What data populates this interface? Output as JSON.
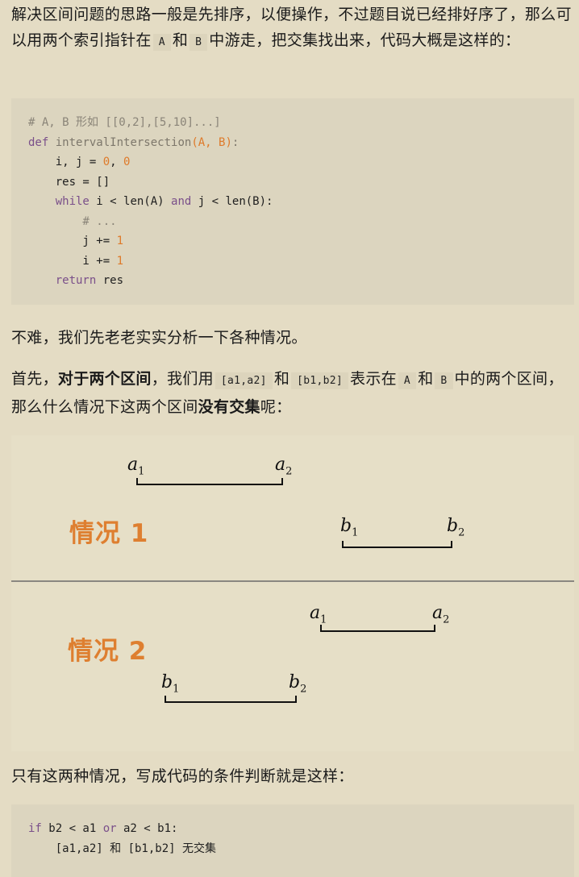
{
  "intro": {
    "text1": "解决区间问题的思路一般是先排序，以便操作，不过题目说已经排好序了，那么可以用两个索引指针在",
    "code_a": "A",
    "and1": "和",
    "code_b": "B",
    "text2": "中游走，把交集找出来，代码大概是这样的："
  },
  "code1": {
    "lines": [
      [
        {
          "t": "# A, B 形如 [[0,2],[5,10]...]",
          "c": "cm"
        }
      ],
      [
        {
          "t": "def",
          "c": "kw"
        },
        {
          "t": " intervalIntersection",
          "c": "fn"
        },
        {
          "t": "(A, B)",
          "c": "num"
        },
        {
          "t": ":",
          "c": "fn"
        }
      ],
      [
        {
          "t": "    i, j = ",
          "c": ""
        },
        {
          "t": "0",
          "c": "num"
        },
        {
          "t": ", ",
          "c": ""
        },
        {
          "t": "0",
          "c": "num"
        }
      ],
      [
        {
          "t": "    res = []",
          "c": ""
        }
      ],
      [
        {
          "t": "    ",
          "c": ""
        },
        {
          "t": "while",
          "c": "kw"
        },
        {
          "t": " i < len(A) ",
          "c": ""
        },
        {
          "t": "and",
          "c": "kw"
        },
        {
          "t": " j < len(B):",
          "c": ""
        }
      ],
      [
        {
          "t": "        # ...",
          "c": "cm"
        }
      ],
      [
        {
          "t": "        j += ",
          "c": ""
        },
        {
          "t": "1",
          "c": "num"
        }
      ],
      [
        {
          "t": "        i += ",
          "c": ""
        },
        {
          "t": "1",
          "c": "num"
        }
      ],
      [
        {
          "t": "    ",
          "c": ""
        },
        {
          "t": "return",
          "c": "kw"
        },
        {
          "t": " res",
          "c": ""
        }
      ]
    ]
  },
  "para2": "不难，我们先老老实实分析一下各种情况。",
  "para3": {
    "t1": "首先，",
    "b1": "对于两个区间",
    "t2": "，我们用",
    "c1": "[a1,a2]",
    "t3": "和",
    "c2": "[b1,b2]",
    "t4": "表示在",
    "c3": "A",
    "t5": "和",
    "c4": "B",
    "t6": "中的两个区间，那么什么情况下这两个区间",
    "b2": "没有交集",
    "t7": "呢："
  },
  "illustration": {
    "case1": "情况 1",
    "case2": "情况 2",
    "a1": "a",
    "a2": "a",
    "b1": "b",
    "b2": "b",
    "s1": "1",
    "s2": "2"
  },
  "para4": "只有这两种情况，写成代码的条件判断就是这样：",
  "code2": {
    "lines": [
      [
        {
          "t": "if",
          "c": "kw"
        },
        {
          "t": " b2 < a1 ",
          "c": ""
        },
        {
          "t": "or",
          "c": "kw"
        },
        {
          "t": " a2 < b1:",
          "c": ""
        }
      ],
      [
        {
          "t": "    [a1,a2] 和 [b1,b2] 无交集",
          "c": ""
        }
      ]
    ]
  }
}
